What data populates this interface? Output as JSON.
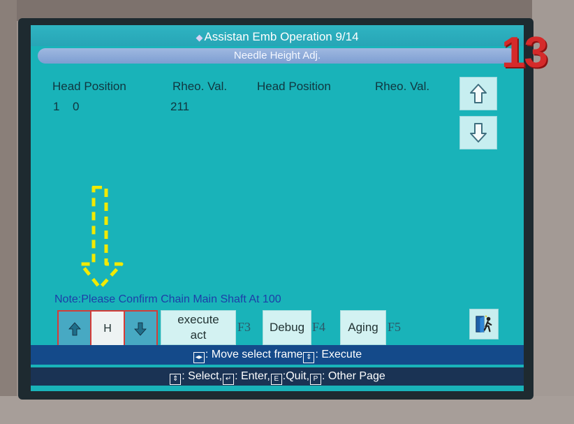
{
  "window": {
    "title": "Assistan Emb Operation 9/14",
    "subtitle": "Needle Height Adj."
  },
  "table": {
    "headers": [
      "Head Position",
      "Rheo. Val.",
      "Head Position",
      "Rheo. Val."
    ],
    "rows": [
      {
        "index": "1",
        "head_position": "0",
        "rheo_val": "211"
      }
    ]
  },
  "note": "Note:Please Confirm Chain Main Shaft At 100",
  "stepper": {
    "value": "H"
  },
  "buttons": {
    "execute_line1": "execute",
    "execute_line2": "act",
    "execute_key": "F3",
    "debug": "Debug",
    "debug_key": "F4",
    "aging": "Aging",
    "aging_key": "F5"
  },
  "help": {
    "line1": ": Move select frame",
    "line1b": ": Execute",
    "line2a": ": Select,",
    "line2b": ": Enter,",
    "line2c": ":Quit,",
    "line2d": ": Other Page"
  },
  "badge": "13",
  "colors": {
    "screen": "#19b3b9",
    "title_bar": "#27a5b6",
    "subtitle_bar": "#7d9ed2",
    "note_text": "#1d3ea8",
    "stepper_border": "#d63b37",
    "help_bar": "#144a8a",
    "badge": "#d52a2a",
    "annotation_arrow": "#f2ea00"
  },
  "icons": [
    "diamond-icon",
    "arrow-up-icon",
    "arrow-down-icon",
    "exit-door-icon",
    "move-frame-key-icon",
    "execute-key-icon",
    "select-key-icon",
    "enter-key-icon",
    "esc-key-icon",
    "page-key-icon",
    "annotation-arrow-icon"
  ]
}
